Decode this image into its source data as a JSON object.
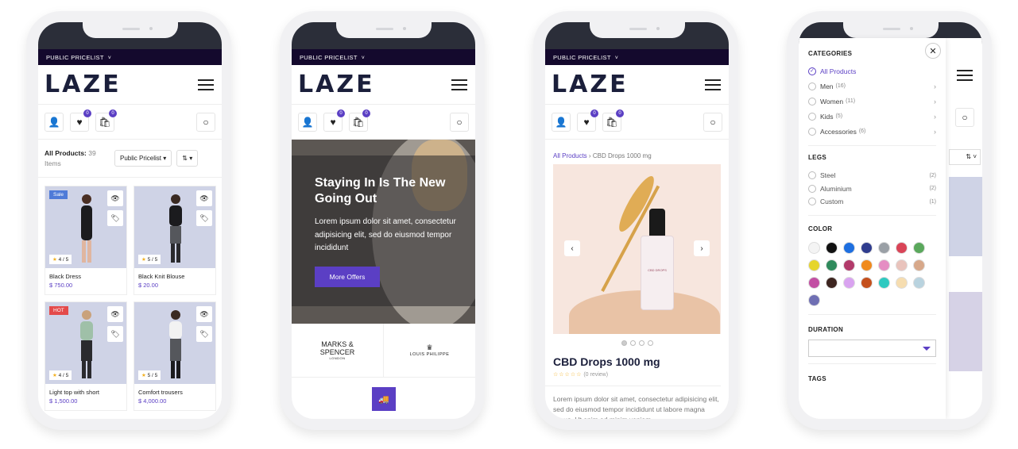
{
  "phone1": {
    "pricebar": "PUBLIC PRICELIST",
    "logo": "LAZE",
    "badges": {
      "wishlist": "0",
      "cart": "0"
    },
    "all_products_label": "All Products:",
    "all_products_count": "39 Items",
    "pricelist_dropdown": "Public Pricelist",
    "products": [
      {
        "name": "Black Dress",
        "price": "$ 750.00",
        "rating": "4 / 5",
        "tag": "Sale"
      },
      {
        "name": "Black Knit Blouse",
        "price": "$ 20.00",
        "rating": "5 / 5",
        "tag": ""
      },
      {
        "name": "Light top with short",
        "price": "$ 1,500.00",
        "rating": "4 / 5",
        "tag": "HOT"
      },
      {
        "name": "Comfort trousers",
        "price": "$ 4,000.00",
        "rating": "5 / 5",
        "tag": ""
      }
    ]
  },
  "phone2": {
    "pricebar": "PUBLIC PRICELIST",
    "logo": "LAZE",
    "badges": {
      "wishlist": "0",
      "cart": "0"
    },
    "hero_title": "Staying In Is The New Going Out",
    "hero_text": "Lorem ipsum dolor sit amet, consectetur adipisicing elit, sed do eiusmod tempor incididunt",
    "hero_button": "More Offers",
    "brand1_line1": "MARKS &",
    "brand1_line2": "SPENCER",
    "brand1_sub": "LONDON",
    "brand2": "LOUIS PHILIPPE"
  },
  "phone3": {
    "pricebar": "PUBLIC PRICELIST",
    "logo": "LAZE",
    "badges": {
      "wishlist": "0",
      "cart": "0"
    },
    "breadcrumb_link": "All Products",
    "breadcrumb_current": "CBD Drops 1000 mg",
    "product_title": "CBD Drops 1000 mg",
    "review": "(0 review)",
    "description": "Lorem ipsum dolor sit amet, consectetur adipisicing elit, sed do eiusmod tempor incididunt ut labore magna aliqua. Ut enim ad minim veniam,",
    "bottle_label": "CBD DROPS"
  },
  "phone4": {
    "categories_title": "CATEGORIES",
    "categories": [
      {
        "label": "All Products",
        "count": ""
      },
      {
        "label": "Men",
        "count": "(16)"
      },
      {
        "label": "Women",
        "count": "(11)"
      },
      {
        "label": "Kids",
        "count": "(5)"
      },
      {
        "label": "Accessories",
        "count": "(6)"
      }
    ],
    "legs_title": "LEGS",
    "legs": [
      {
        "label": "Steel",
        "count": "(2)"
      },
      {
        "label": "Aluminium",
        "count": "(2)"
      },
      {
        "label": "Custom",
        "count": "(1)"
      }
    ],
    "color_title": "COLOR",
    "colors": [
      "#f4f4f4",
      "#111111",
      "#1e6fe0",
      "#2f3c8e",
      "#9aa0a6",
      "#d94457",
      "#5aa85c",
      "#e6d52c",
      "#2f8a5c",
      "#b23a6a",
      "#f08a1c",
      "#e58ec3",
      "#e9c3bc",
      "#d7a88a",
      "#c24fa3",
      "#3d2520",
      "#d9a3f0",
      "#c4501c",
      "#2fc9c0",
      "#f6ddb0",
      "#b9d3df",
      "#6f6fb3"
    ],
    "duration_title": "DURATION",
    "tags_title": "TAGS"
  }
}
